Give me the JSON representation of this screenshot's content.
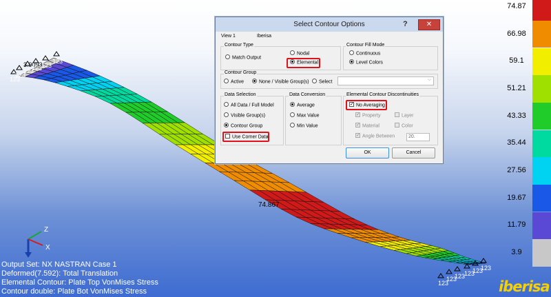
{
  "viewport": {
    "max_label": "74.867",
    "node_labels": [
      "123",
      "123",
      "123",
      "123",
      "123",
      "123",
      "123",
      "123",
      "123",
      "123",
      "123",
      "123"
    ],
    "top_left_values": "3.9093"
  },
  "axis": {
    "z": "Z",
    "x": "X"
  },
  "legend": {
    "values": [
      "74.87",
      "66.98",
      "59.1",
      "51.21",
      "43.33",
      "35.44",
      "27.56",
      "19.67",
      "11.79",
      "3.9"
    ],
    "colors": [
      "#cf1a19",
      "#f08c00",
      "#f2ee00",
      "#9fe000",
      "#20cc2a",
      "#00d9a0",
      "#00d2f2",
      "#1a58e8",
      "#5a49d4",
      "#c8c8c8"
    ]
  },
  "status": {
    "line1": "Output Set: NX NASTRAN Case 1",
    "line2": "Deformed(7.592): Total Translation",
    "line3": "Elemental Contour: Plate Top VonMises Stress",
    "line4": "Contour double: Plate Bot VonMises Stress"
  },
  "logo": {
    "text": "iberisa"
  },
  "dialog": {
    "title": "Select Contour Options",
    "help": "?",
    "close": "✕",
    "view_label": "View 1",
    "view_name": "Iberisa",
    "contour_type": {
      "title": "Contour Type",
      "match_output": "Match Output",
      "nodal": "Nodal",
      "elemental": "Elemental"
    },
    "fill_mode": {
      "title": "Contour Fill Mode",
      "continuous": "Continuous",
      "level_colors": "Level Colors"
    },
    "contour_group": {
      "title": "Contour Group",
      "active": "Active",
      "none_visible": "None / Visible Group(s)",
      "select": "Select"
    },
    "data_selection": {
      "title": "Data Selection",
      "all_data": "All Data / Full Model",
      "visible_groups": "Visible Group(s)",
      "contour_group": "Contour Group",
      "use_corner": "Use Corner Data"
    },
    "data_conversion": {
      "title": "Data Conversion",
      "average": "Average",
      "max_value": "Max Value",
      "min_value": "Min Value"
    },
    "discontinuities": {
      "title": "Elemental Contour Discontinuities",
      "no_averaging": "No Averaging",
      "property": "Property",
      "layer": "Layer",
      "material": "Material",
      "color": "Color",
      "angle_between": "Angle Between",
      "angle_value": "20."
    },
    "ok": "OK",
    "cancel": "Cancel"
  }
}
